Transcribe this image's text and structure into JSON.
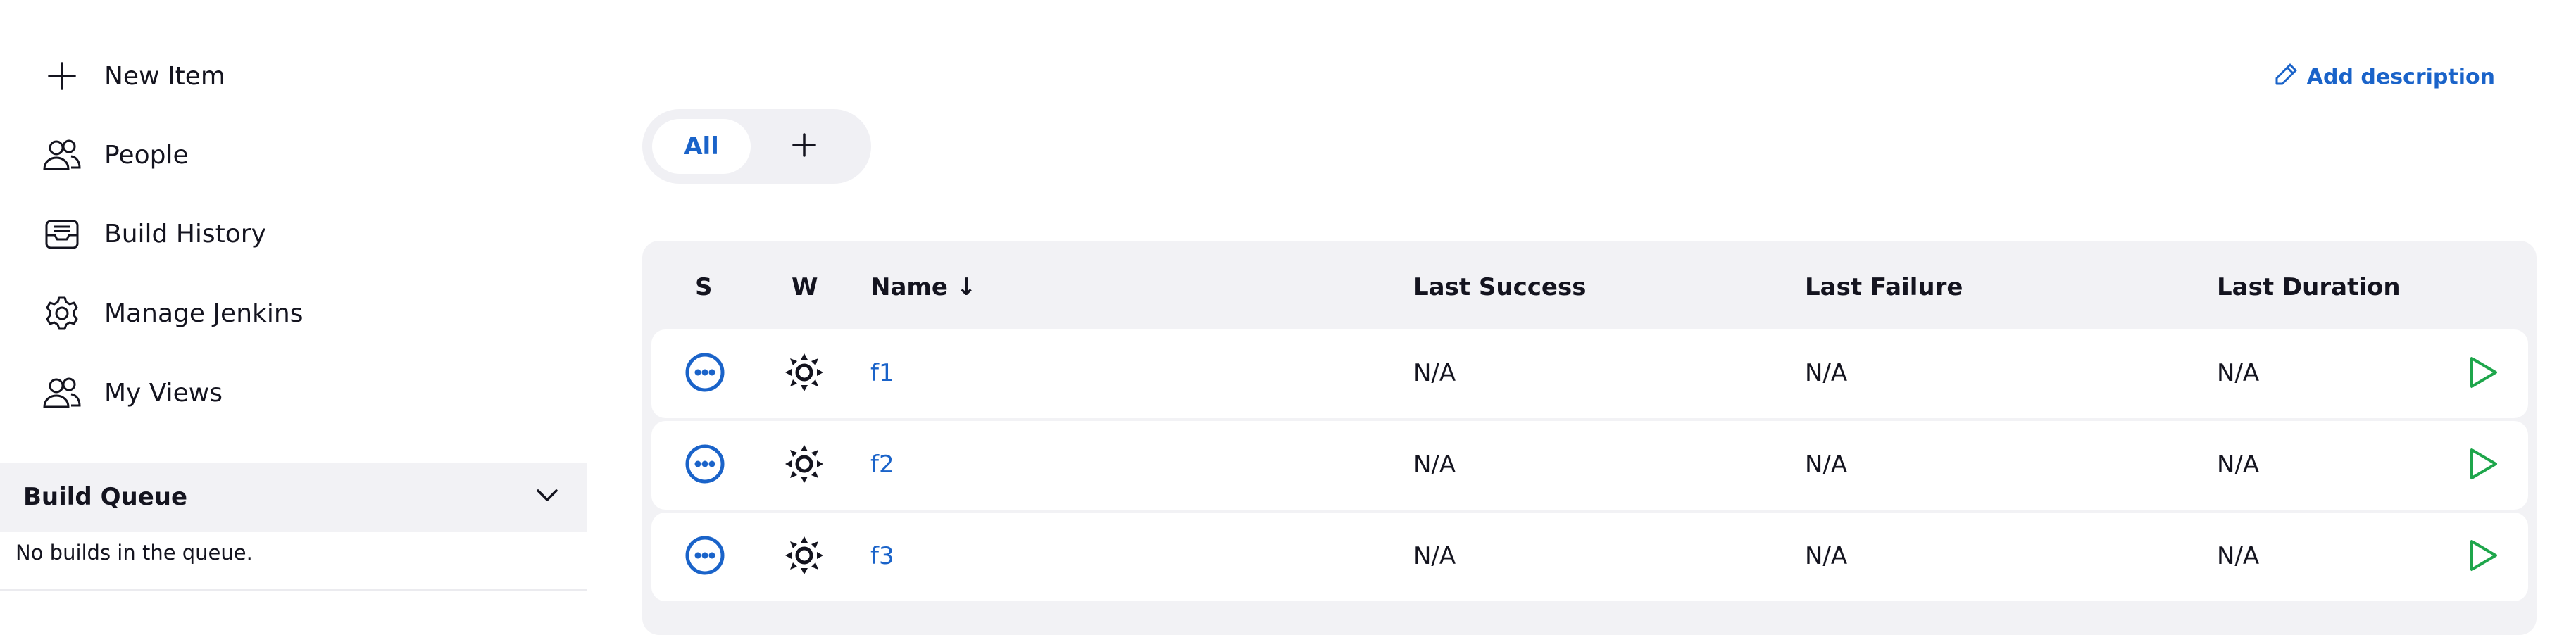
{
  "sidebar": {
    "items": [
      {
        "label": "New Item",
        "icon": "plus-icon"
      },
      {
        "label": "People",
        "icon": "people-icon"
      },
      {
        "label": "Build History",
        "icon": "inbox-icon"
      },
      {
        "label": "Manage Jenkins",
        "icon": "gear-icon"
      },
      {
        "label": "My Views",
        "icon": "people-icon"
      }
    ],
    "build_queue": {
      "title": "Build Queue",
      "empty_text": "No builds in the queue."
    }
  },
  "header": {
    "add_description": "Add description"
  },
  "view_tabs": {
    "active": "All",
    "add_icon": "plus-icon"
  },
  "table": {
    "columns": {
      "s": "S",
      "w": "W",
      "name": "Name ↓",
      "last_success": "Last Success",
      "last_failure": "Last Failure",
      "last_duration": "Last Duration"
    },
    "rows": [
      {
        "name": "f1",
        "last_success": "N/A",
        "last_failure": "N/A",
        "last_duration": "N/A"
      },
      {
        "name": "f2",
        "last_success": "N/A",
        "last_failure": "N/A",
        "last_duration": "N/A"
      },
      {
        "name": "f3",
        "last_success": "N/A",
        "last_failure": "N/A",
        "last_duration": "N/A"
      }
    ]
  },
  "colors": {
    "accent": "#1a63c9",
    "run": "#1ea64b",
    "panel": "#f2f2f5"
  }
}
